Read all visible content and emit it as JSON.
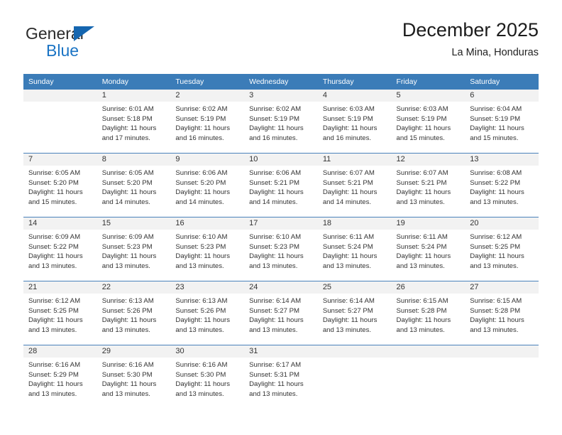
{
  "logo": {
    "primary_text": "General",
    "secondary_text": "Blue",
    "primary_color": "#2b2b2b",
    "secondary_color": "#1b74c4",
    "triangle_color": "#1566b0",
    "icon": "general-blue-logo"
  },
  "header": {
    "title": "December 2025",
    "subtitle": "La Mina, Honduras"
  },
  "theme": {
    "header_bg": "#3b7cb8",
    "header_text": "#ffffff",
    "daynum_band_bg": "#f2f2f2",
    "row_separator": "#4a82bb",
    "body_text": "#333333"
  },
  "weekdays": [
    "Sunday",
    "Monday",
    "Tuesday",
    "Wednesday",
    "Thursday",
    "Friday",
    "Saturday"
  ],
  "calendar": {
    "month": "December",
    "year": "2025",
    "location": "La Mina, Honduras",
    "weeks": [
      [
        {
          "day": "",
          "lines": []
        },
        {
          "day": "1",
          "lines": [
            "Sunrise: 6:01 AM",
            "Sunset: 5:18 PM",
            "Daylight: 11 hours",
            "and 17 minutes."
          ]
        },
        {
          "day": "2",
          "lines": [
            "Sunrise: 6:02 AM",
            "Sunset: 5:19 PM",
            "Daylight: 11 hours",
            "and 16 minutes."
          ]
        },
        {
          "day": "3",
          "lines": [
            "Sunrise: 6:02 AM",
            "Sunset: 5:19 PM",
            "Daylight: 11 hours",
            "and 16 minutes."
          ]
        },
        {
          "day": "4",
          "lines": [
            "Sunrise: 6:03 AM",
            "Sunset: 5:19 PM",
            "Daylight: 11 hours",
            "and 16 minutes."
          ]
        },
        {
          "day": "5",
          "lines": [
            "Sunrise: 6:03 AM",
            "Sunset: 5:19 PM",
            "Daylight: 11 hours",
            "and 15 minutes."
          ]
        },
        {
          "day": "6",
          "lines": [
            "Sunrise: 6:04 AM",
            "Sunset: 5:19 PM",
            "Daylight: 11 hours",
            "and 15 minutes."
          ]
        }
      ],
      [
        {
          "day": "7",
          "lines": [
            "Sunrise: 6:05 AM",
            "Sunset: 5:20 PM",
            "Daylight: 11 hours",
            "and 15 minutes."
          ]
        },
        {
          "day": "8",
          "lines": [
            "Sunrise: 6:05 AM",
            "Sunset: 5:20 PM",
            "Daylight: 11 hours",
            "and 14 minutes."
          ]
        },
        {
          "day": "9",
          "lines": [
            "Sunrise: 6:06 AM",
            "Sunset: 5:20 PM",
            "Daylight: 11 hours",
            "and 14 minutes."
          ]
        },
        {
          "day": "10",
          "lines": [
            "Sunrise: 6:06 AM",
            "Sunset: 5:21 PM",
            "Daylight: 11 hours",
            "and 14 minutes."
          ]
        },
        {
          "day": "11",
          "lines": [
            "Sunrise: 6:07 AM",
            "Sunset: 5:21 PM",
            "Daylight: 11 hours",
            "and 14 minutes."
          ]
        },
        {
          "day": "12",
          "lines": [
            "Sunrise: 6:07 AM",
            "Sunset: 5:21 PM",
            "Daylight: 11 hours",
            "and 13 minutes."
          ]
        },
        {
          "day": "13",
          "lines": [
            "Sunrise: 6:08 AM",
            "Sunset: 5:22 PM",
            "Daylight: 11 hours",
            "and 13 minutes."
          ]
        }
      ],
      [
        {
          "day": "14",
          "lines": [
            "Sunrise: 6:09 AM",
            "Sunset: 5:22 PM",
            "Daylight: 11 hours",
            "and 13 minutes."
          ]
        },
        {
          "day": "15",
          "lines": [
            "Sunrise: 6:09 AM",
            "Sunset: 5:23 PM",
            "Daylight: 11 hours",
            "and 13 minutes."
          ]
        },
        {
          "day": "16",
          "lines": [
            "Sunrise: 6:10 AM",
            "Sunset: 5:23 PM",
            "Daylight: 11 hours",
            "and 13 minutes."
          ]
        },
        {
          "day": "17",
          "lines": [
            "Sunrise: 6:10 AM",
            "Sunset: 5:23 PM",
            "Daylight: 11 hours",
            "and 13 minutes."
          ]
        },
        {
          "day": "18",
          "lines": [
            "Sunrise: 6:11 AM",
            "Sunset: 5:24 PM",
            "Daylight: 11 hours",
            "and 13 minutes."
          ]
        },
        {
          "day": "19",
          "lines": [
            "Sunrise: 6:11 AM",
            "Sunset: 5:24 PM",
            "Daylight: 11 hours",
            "and 13 minutes."
          ]
        },
        {
          "day": "20",
          "lines": [
            "Sunrise: 6:12 AM",
            "Sunset: 5:25 PM",
            "Daylight: 11 hours",
            "and 13 minutes."
          ]
        }
      ],
      [
        {
          "day": "21",
          "lines": [
            "Sunrise: 6:12 AM",
            "Sunset: 5:25 PM",
            "Daylight: 11 hours",
            "and 13 minutes."
          ]
        },
        {
          "day": "22",
          "lines": [
            "Sunrise: 6:13 AM",
            "Sunset: 5:26 PM",
            "Daylight: 11 hours",
            "and 13 minutes."
          ]
        },
        {
          "day": "23",
          "lines": [
            "Sunrise: 6:13 AM",
            "Sunset: 5:26 PM",
            "Daylight: 11 hours",
            "and 13 minutes."
          ]
        },
        {
          "day": "24",
          "lines": [
            "Sunrise: 6:14 AM",
            "Sunset: 5:27 PM",
            "Daylight: 11 hours",
            "and 13 minutes."
          ]
        },
        {
          "day": "25",
          "lines": [
            "Sunrise: 6:14 AM",
            "Sunset: 5:27 PM",
            "Daylight: 11 hours",
            "and 13 minutes."
          ]
        },
        {
          "day": "26",
          "lines": [
            "Sunrise: 6:15 AM",
            "Sunset: 5:28 PM",
            "Daylight: 11 hours",
            "and 13 minutes."
          ]
        },
        {
          "day": "27",
          "lines": [
            "Sunrise: 6:15 AM",
            "Sunset: 5:28 PM",
            "Daylight: 11 hours",
            "and 13 minutes."
          ]
        }
      ],
      [
        {
          "day": "28",
          "lines": [
            "Sunrise: 6:16 AM",
            "Sunset: 5:29 PM",
            "Daylight: 11 hours",
            "and 13 minutes."
          ]
        },
        {
          "day": "29",
          "lines": [
            "Sunrise: 6:16 AM",
            "Sunset: 5:30 PM",
            "Daylight: 11 hours",
            "and 13 minutes."
          ]
        },
        {
          "day": "30",
          "lines": [
            "Sunrise: 6:16 AM",
            "Sunset: 5:30 PM",
            "Daylight: 11 hours",
            "and 13 minutes."
          ]
        },
        {
          "day": "31",
          "lines": [
            "Sunrise: 6:17 AM",
            "Sunset: 5:31 PM",
            "Daylight: 11 hours",
            "and 13 minutes."
          ]
        },
        {
          "day": "",
          "lines": []
        },
        {
          "day": "",
          "lines": []
        },
        {
          "day": "",
          "lines": []
        }
      ]
    ]
  }
}
